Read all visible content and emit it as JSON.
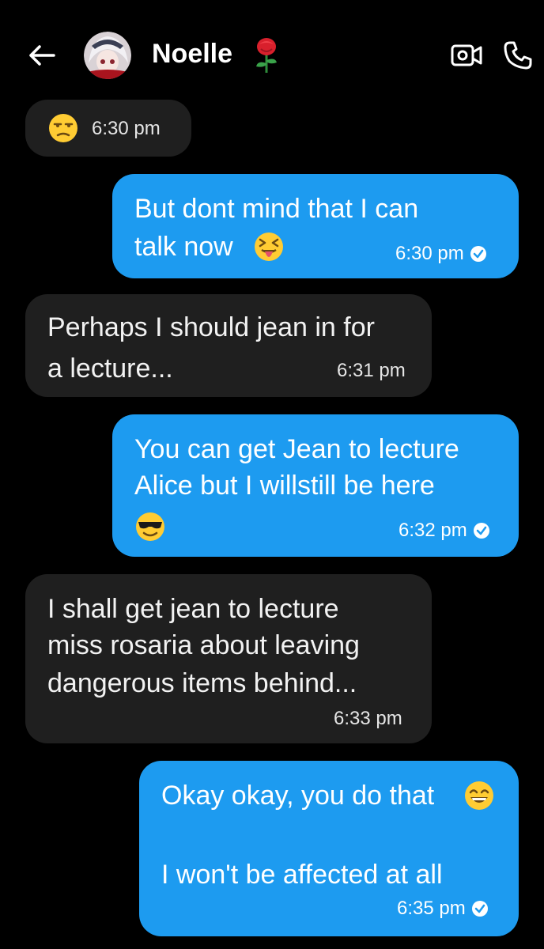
{
  "header": {
    "contact_name": "Noelle",
    "contact_emoji": "rose-emoji",
    "back_icon": "back-arrow-icon",
    "video_icon": "video-call-icon",
    "call_icon": "phone-icon"
  },
  "messages": [
    {
      "direction": "incoming",
      "lines": [],
      "emoji": "unamused-face-emoji",
      "time": "6:30 pm"
    },
    {
      "direction": "outgoing",
      "lines": [
        "But dont mind that I can",
        "talk now"
      ],
      "emoji": "squinting-face-with-tongue-emoji",
      "time": "6:30 pm",
      "status": "read-check-icon"
    },
    {
      "direction": "incoming",
      "lines": [
        "Perhaps I should jean in for",
        "a lecture..."
      ],
      "time": "6:31 pm"
    },
    {
      "direction": "outgoing",
      "lines": [
        "You can get Jean to lecture",
        "Alice but I willstill be here"
      ],
      "emoji": "smiling-face-with-sunglasses-emoji",
      "time": "6:32 pm",
      "status": "read-check-icon"
    },
    {
      "direction": "incoming",
      "lines": [
        "I shall get jean to lecture",
        "miss rosaria about leaving",
        "dangerous items behind..."
      ],
      "time": "6:33 pm"
    },
    {
      "direction": "outgoing",
      "lines": [
        "Okay okay, you do that",
        "",
        "I won't be affected at all"
      ],
      "emoji": "grinning-face-with-smiling-eyes-emoji",
      "time": "6:35 pm",
      "status": "read-check-icon"
    }
  ],
  "colors": {
    "background": "#000000",
    "incoming_bubble": "#1f1f1f",
    "outgoing_bubble": "#1d9bf0"
  }
}
